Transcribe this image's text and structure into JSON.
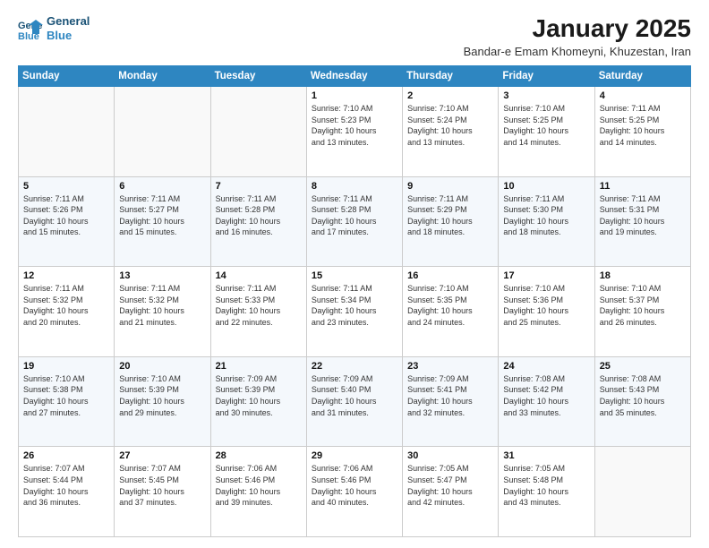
{
  "header": {
    "logo_line1": "General",
    "logo_line2": "Blue",
    "month_title": "January 2025",
    "subtitle": "Bandar-e Emam Khomeyni, Khuzestan, Iran"
  },
  "weekdays": [
    "Sunday",
    "Monday",
    "Tuesday",
    "Wednesday",
    "Thursday",
    "Friday",
    "Saturday"
  ],
  "weeks": [
    [
      {
        "day": "",
        "info": ""
      },
      {
        "day": "",
        "info": ""
      },
      {
        "day": "",
        "info": ""
      },
      {
        "day": "1",
        "info": "Sunrise: 7:10 AM\nSunset: 5:23 PM\nDaylight: 10 hours\nand 13 minutes."
      },
      {
        "day": "2",
        "info": "Sunrise: 7:10 AM\nSunset: 5:24 PM\nDaylight: 10 hours\nand 13 minutes."
      },
      {
        "day": "3",
        "info": "Sunrise: 7:10 AM\nSunset: 5:25 PM\nDaylight: 10 hours\nand 14 minutes."
      },
      {
        "day": "4",
        "info": "Sunrise: 7:11 AM\nSunset: 5:25 PM\nDaylight: 10 hours\nand 14 minutes."
      }
    ],
    [
      {
        "day": "5",
        "info": "Sunrise: 7:11 AM\nSunset: 5:26 PM\nDaylight: 10 hours\nand 15 minutes."
      },
      {
        "day": "6",
        "info": "Sunrise: 7:11 AM\nSunset: 5:27 PM\nDaylight: 10 hours\nand 15 minutes."
      },
      {
        "day": "7",
        "info": "Sunrise: 7:11 AM\nSunset: 5:28 PM\nDaylight: 10 hours\nand 16 minutes."
      },
      {
        "day": "8",
        "info": "Sunrise: 7:11 AM\nSunset: 5:28 PM\nDaylight: 10 hours\nand 17 minutes."
      },
      {
        "day": "9",
        "info": "Sunrise: 7:11 AM\nSunset: 5:29 PM\nDaylight: 10 hours\nand 18 minutes."
      },
      {
        "day": "10",
        "info": "Sunrise: 7:11 AM\nSunset: 5:30 PM\nDaylight: 10 hours\nand 18 minutes."
      },
      {
        "day": "11",
        "info": "Sunrise: 7:11 AM\nSunset: 5:31 PM\nDaylight: 10 hours\nand 19 minutes."
      }
    ],
    [
      {
        "day": "12",
        "info": "Sunrise: 7:11 AM\nSunset: 5:32 PM\nDaylight: 10 hours\nand 20 minutes."
      },
      {
        "day": "13",
        "info": "Sunrise: 7:11 AM\nSunset: 5:32 PM\nDaylight: 10 hours\nand 21 minutes."
      },
      {
        "day": "14",
        "info": "Sunrise: 7:11 AM\nSunset: 5:33 PM\nDaylight: 10 hours\nand 22 minutes."
      },
      {
        "day": "15",
        "info": "Sunrise: 7:11 AM\nSunset: 5:34 PM\nDaylight: 10 hours\nand 23 minutes."
      },
      {
        "day": "16",
        "info": "Sunrise: 7:10 AM\nSunset: 5:35 PM\nDaylight: 10 hours\nand 24 minutes."
      },
      {
        "day": "17",
        "info": "Sunrise: 7:10 AM\nSunset: 5:36 PM\nDaylight: 10 hours\nand 25 minutes."
      },
      {
        "day": "18",
        "info": "Sunrise: 7:10 AM\nSunset: 5:37 PM\nDaylight: 10 hours\nand 26 minutes."
      }
    ],
    [
      {
        "day": "19",
        "info": "Sunrise: 7:10 AM\nSunset: 5:38 PM\nDaylight: 10 hours\nand 27 minutes."
      },
      {
        "day": "20",
        "info": "Sunrise: 7:10 AM\nSunset: 5:39 PM\nDaylight: 10 hours\nand 29 minutes."
      },
      {
        "day": "21",
        "info": "Sunrise: 7:09 AM\nSunset: 5:39 PM\nDaylight: 10 hours\nand 30 minutes."
      },
      {
        "day": "22",
        "info": "Sunrise: 7:09 AM\nSunset: 5:40 PM\nDaylight: 10 hours\nand 31 minutes."
      },
      {
        "day": "23",
        "info": "Sunrise: 7:09 AM\nSunset: 5:41 PM\nDaylight: 10 hours\nand 32 minutes."
      },
      {
        "day": "24",
        "info": "Sunrise: 7:08 AM\nSunset: 5:42 PM\nDaylight: 10 hours\nand 33 minutes."
      },
      {
        "day": "25",
        "info": "Sunrise: 7:08 AM\nSunset: 5:43 PM\nDaylight: 10 hours\nand 35 minutes."
      }
    ],
    [
      {
        "day": "26",
        "info": "Sunrise: 7:07 AM\nSunset: 5:44 PM\nDaylight: 10 hours\nand 36 minutes."
      },
      {
        "day": "27",
        "info": "Sunrise: 7:07 AM\nSunset: 5:45 PM\nDaylight: 10 hours\nand 37 minutes."
      },
      {
        "day": "28",
        "info": "Sunrise: 7:06 AM\nSunset: 5:46 PM\nDaylight: 10 hours\nand 39 minutes."
      },
      {
        "day": "29",
        "info": "Sunrise: 7:06 AM\nSunset: 5:46 PM\nDaylight: 10 hours\nand 40 minutes."
      },
      {
        "day": "30",
        "info": "Sunrise: 7:05 AM\nSunset: 5:47 PM\nDaylight: 10 hours\nand 42 minutes."
      },
      {
        "day": "31",
        "info": "Sunrise: 7:05 AM\nSunset: 5:48 PM\nDaylight: 10 hours\nand 43 minutes."
      },
      {
        "day": "",
        "info": ""
      }
    ]
  ]
}
